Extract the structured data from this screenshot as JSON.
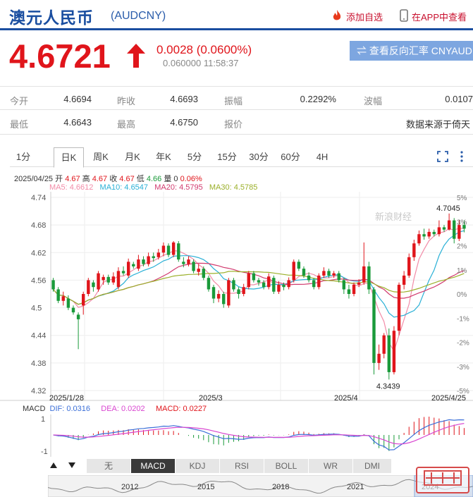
{
  "header": {
    "title": "澳元人民币",
    "code": "(AUDCNY)",
    "add_fav": "添加自选",
    "app_view": "在APP中查看"
  },
  "quote": {
    "price": "4.6721",
    "change": "0.0028 (0.0600%)",
    "sub": "0.060000 11:58:37",
    "reverse_button": "⇌ 查看反向汇率 CNYAUD",
    "color_up": "#e0151b"
  },
  "stats": {
    "row1": [
      {
        "label": "今开",
        "value": "4.6694"
      },
      {
        "label": "昨收",
        "value": "4.6693"
      },
      {
        "label": "振幅",
        "value": "0.2292%"
      },
      {
        "label": "波幅",
        "value": "0.0107"
      }
    ],
    "row2": [
      {
        "label": "最低",
        "value": "4.6643"
      },
      {
        "label": "最高",
        "value": "4.6750"
      },
      {
        "label": "报价",
        "value": ""
      },
      {
        "label": "",
        "value": "数据来源于倚天"
      }
    ]
  },
  "tabs": [
    "1分",
    "日K",
    "周K",
    "月K",
    "年K",
    "5分",
    "15分",
    "30分",
    "60分",
    "4H"
  ],
  "selected_tab": "日K",
  "chart_info": {
    "date": "2025/04/25",
    "open_label": "开",
    "open": "4.67",
    "high_label": "高",
    "high": "4.67",
    "close_label": "收",
    "close": "4.67",
    "low_label": "低",
    "low": "4.66",
    "vol_label": "量",
    "vol": "0",
    "pct": "0.06%",
    "ma5": "MA5: 4.6612",
    "ma10": "MA10: 4.6547",
    "ma20": "MA20: 4.5795",
    "ma30": "MA30: 4.5785"
  },
  "macd_info": {
    "label": "MACD",
    "dif": "DIF: 0.0316",
    "dea": "DEA: 0.0202",
    "macd": "MACD: 0.0227"
  },
  "indicator_tabs": [
    "无",
    "MACD",
    "KDJ",
    "RSI",
    "BOLL",
    "WR",
    "DMI"
  ],
  "selected_indicator": "MACD",
  "scroll_years": [
    "2012",
    "2015",
    "2018",
    "2021",
    "2024"
  ],
  "watermark": "新浪财经",
  "chart_data": {
    "type": "candlestick",
    "y_ticks": [
      "4.74",
      "4.68",
      "4.62",
      "4.56",
      "4.5",
      "4.44",
      "4.38",
      "4.32"
    ],
    "ylim": [
      4.32,
      4.74
    ],
    "pct_ticks": [
      "5%",
      "3%",
      "2%",
      "1%",
      "0%",
      "-1%",
      "-2%",
      "-3%",
      "-5%"
    ],
    "x_labels": [
      "2025/1/28",
      "2025/3",
      "2025/4",
      "2025/4/25"
    ],
    "annotations": {
      "high": "4.7045",
      "low": "4.3439"
    },
    "macd_ticks": [
      "1",
      "-1"
    ],
    "colors": {
      "up": "#e0151b",
      "down": "#1a9a3a",
      "ma5": "#f28ca8",
      "ma10": "#29b0d6",
      "ma20": "#d13a6e",
      "ma30": "#9bb02a",
      "dif": "#3b6fd8",
      "dea": "#d946d0"
    },
    "candles": [
      [
        4.56,
        4.54,
        4.565,
        4.535
      ],
      [
        4.54,
        4.515,
        4.545,
        4.51
      ],
      [
        4.515,
        4.525,
        4.535,
        4.505
      ],
      [
        4.52,
        4.5,
        4.527,
        4.495
      ],
      [
        4.5,
        4.49,
        4.505,
        4.485
      ],
      [
        4.485,
        4.475,
        4.49,
        4.41
      ],
      [
        4.505,
        4.53,
        4.535,
        4.485
      ],
      [
        4.53,
        4.56,
        4.565,
        4.525
      ],
      [
        4.555,
        4.545,
        4.56,
        4.535
      ],
      [
        4.54,
        4.575,
        4.58,
        4.535
      ],
      [
        4.56,
        4.567,
        4.572,
        4.55
      ],
      [
        4.567,
        4.555,
        4.572,
        4.55
      ],
      [
        4.555,
        4.568,
        4.577,
        4.55
      ],
      [
        4.545,
        4.58,
        4.588,
        4.54
      ],
      [
        4.58,
        4.575,
        4.59,
        4.57
      ],
      [
        4.57,
        4.6,
        4.607,
        4.565
      ],
      [
        4.595,
        4.59,
        4.6,
        4.585
      ],
      [
        4.585,
        4.605,
        4.615,
        4.58
      ],
      [
        4.605,
        4.595,
        4.612,
        4.59
      ],
      [
        4.595,
        4.612,
        4.62,
        4.59
      ],
      [
        4.612,
        4.608,
        4.62,
        4.6
      ],
      [
        4.61,
        4.62,
        4.628,
        4.605
      ],
      [
        4.62,
        4.635,
        4.642,
        4.612
      ],
      [
        4.635,
        4.615,
        4.64,
        4.61
      ],
      [
        4.615,
        4.642,
        4.645,
        4.61
      ],
      [
        4.64,
        4.605,
        4.645,
        4.6
      ],
      [
        4.6,
        4.595,
        4.61,
        4.588
      ],
      [
        4.595,
        4.605,
        4.612,
        4.59
      ],
      [
        4.6,
        4.58,
        4.605,
        4.575
      ],
      [
        4.578,
        4.585,
        4.595,
        4.57
      ],
      [
        4.585,
        4.565,
        4.59,
        4.56
      ],
      [
        4.565,
        4.54,
        4.57,
        4.535
      ],
      [
        4.545,
        4.52,
        4.55,
        4.51
      ],
      [
        4.52,
        4.53,
        4.538,
        4.512
      ],
      [
        4.53,
        4.508,
        4.535,
        4.5
      ],
      [
        4.505,
        4.56,
        4.565,
        4.5
      ],
      [
        4.56,
        4.54,
        4.565,
        4.535
      ],
      [
        4.54,
        4.53,
        4.545,
        4.52
      ],
      [
        4.53,
        4.545,
        4.552,
        4.525
      ],
      [
        4.545,
        4.575,
        4.58,
        4.54
      ],
      [
        4.575,
        4.56,
        4.58,
        4.555
      ],
      [
        4.56,
        4.555,
        4.565,
        4.548
      ],
      [
        4.555,
        4.545,
        4.56,
        4.54
      ],
      [
        4.545,
        4.568,
        4.575,
        4.54
      ],
      [
        4.565,
        4.535,
        4.57,
        4.53
      ],
      [
        4.535,
        4.55,
        4.558,
        4.53
      ],
      [
        4.55,
        4.545,
        4.555,
        4.538
      ],
      [
        4.545,
        4.56,
        4.566,
        4.54
      ],
      [
        4.56,
        4.6,
        4.605,
        4.555
      ],
      [
        4.6,
        4.585,
        4.605,
        4.58
      ],
      [
        4.585,
        4.57,
        4.59,
        4.565
      ],
      [
        4.57,
        4.56,
        4.577,
        4.555
      ],
      [
        4.56,
        4.545,
        4.565,
        4.54
      ],
      [
        4.545,
        4.57,
        4.575,
        4.54
      ],
      [
        4.57,
        4.58,
        4.588,
        4.565
      ],
      [
        4.58,
        4.57,
        4.585,
        4.565
      ],
      [
        4.57,
        4.575,
        4.58,
        4.565
      ],
      [
        4.575,
        4.56,
        4.58,
        4.555
      ],
      [
        4.56,
        4.54,
        4.565,
        4.53
      ],
      [
        4.54,
        4.53,
        4.55,
        4.52
      ],
      [
        4.53,
        4.55,
        4.555,
        4.525
      ],
      [
        4.55,
        4.555,
        4.562,
        4.545
      ],
      [
        4.555,
        4.59,
        4.642,
        4.55
      ],
      [
        4.59,
        4.54,
        4.6,
        4.53
      ],
      [
        4.54,
        4.38,
        4.545,
        4.355
      ],
      [
        4.38,
        4.4,
        4.42,
        4.365
      ],
      [
        4.4,
        4.44,
        4.445,
        4.39
      ],
      [
        4.44,
        4.36,
        4.455,
        4.344
      ],
      [
        4.36,
        4.45,
        4.46,
        4.355
      ],
      [
        4.45,
        4.55,
        4.555,
        4.44
      ],
      [
        4.55,
        4.57,
        4.58,
        4.54
      ],
      [
        4.57,
        4.61,
        4.618,
        4.565
      ],
      [
        4.61,
        4.64,
        4.648,
        4.602
      ],
      [
        4.64,
        4.66,
        4.668,
        4.635
      ],
      [
        4.66,
        4.655,
        4.672,
        4.648
      ],
      [
        4.655,
        4.665,
        4.672,
        4.65
      ],
      [
        4.665,
        4.66,
        4.67,
        4.655
      ],
      [
        4.66,
        4.675,
        4.69,
        4.655
      ],
      [
        4.675,
        4.67,
        4.68,
        4.665
      ],
      [
        4.67,
        4.69,
        4.705,
        4.668
      ],
      [
        4.69,
        4.65,
        4.695,
        4.64
      ],
      [
        4.65,
        4.68,
        4.69,
        4.645
      ],
      [
        4.68,
        4.672,
        4.69,
        4.664
      ]
    ]
  }
}
